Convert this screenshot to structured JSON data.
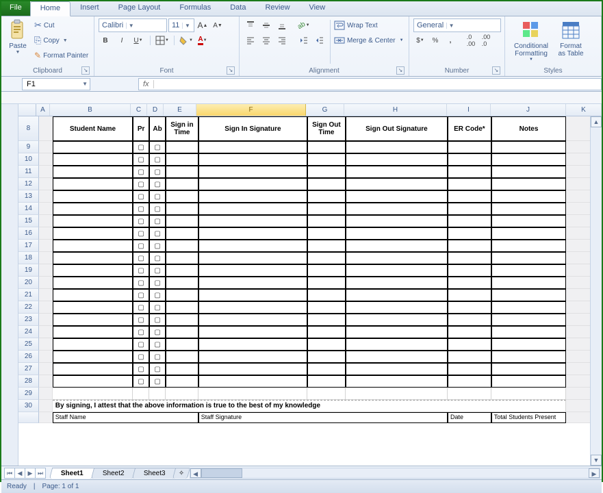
{
  "tabs": {
    "file": "File",
    "home": "Home",
    "insert": "Insert",
    "page_layout": "Page Layout",
    "formulas": "Formulas",
    "data": "Data",
    "review": "Review",
    "view": "View"
  },
  "ribbon": {
    "clipboard": {
      "label": "Clipboard",
      "paste": "Paste",
      "cut": "Cut",
      "copy": "Copy",
      "format_painter": "Format Painter"
    },
    "font": {
      "label": "Font",
      "name": "Calibri",
      "size": "11"
    },
    "alignment": {
      "label": "Alignment",
      "wrap": "Wrap Text",
      "merge": "Merge & Center"
    },
    "number": {
      "label": "Number",
      "format": "General"
    },
    "styles": {
      "label": "Styles",
      "conditional": "Conditional Formatting",
      "format_table": "Format as Table"
    }
  },
  "namebox": "F1",
  "fx": "fx",
  "columns": [
    "A",
    "B",
    "C",
    "D",
    "E",
    "F",
    "G",
    "H",
    "I",
    "J",
    "K"
  ],
  "selected_col": "F",
  "first_row": 8,
  "row_count": 21,
  "headers": {
    "b": "Student Name",
    "c": "Pr",
    "d": "Ab",
    "e": "Sign in Time",
    "f": "Sign In Signature",
    "g": "Sign Out Time",
    "h": "Sign Out Signature",
    "i": "ER Code*",
    "j": "Notes"
  },
  "attest": "By signing, I attest that the above information is true to the best of my knowledge",
  "footer": {
    "staff_name": "Staff Name",
    "staff_sig": "Staff Signature",
    "date": "Date",
    "total": "Total Students Present"
  },
  "sheets": [
    "Sheet1",
    "Sheet2",
    "Sheet3"
  ],
  "active_sheet": "Sheet1",
  "status": {
    "ready": "Ready",
    "page": "Page: 1 of 1"
  }
}
